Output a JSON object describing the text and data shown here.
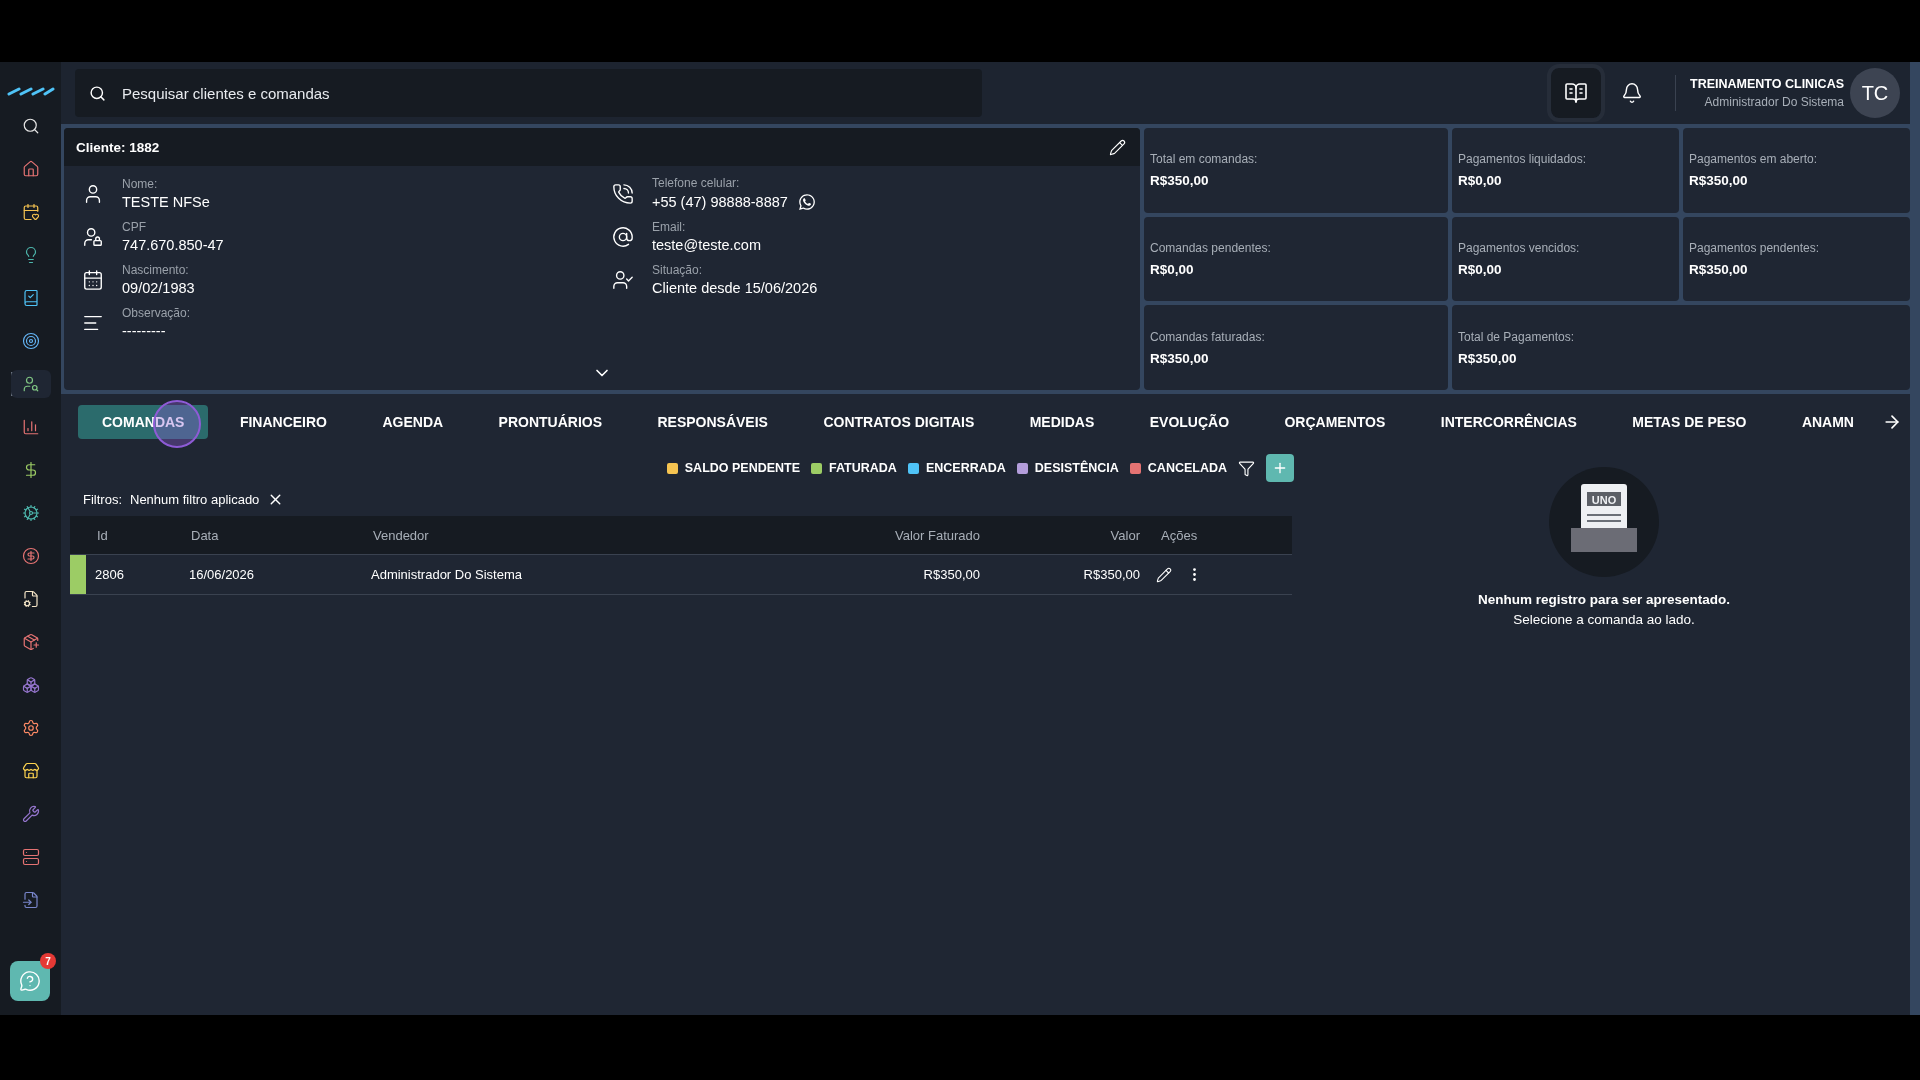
{
  "sidebar": {
    "items": [
      {
        "kind": "search",
        "selected": false
      },
      {
        "kind": "home",
        "selected": false
      },
      {
        "kind": "calendar",
        "selected": false
      },
      {
        "kind": "bulb",
        "selected": false
      },
      {
        "kind": "book",
        "selected": false
      },
      {
        "kind": "target",
        "selected": false
      },
      {
        "kind": "user",
        "selected": true
      },
      {
        "kind": "chart",
        "selected": false
      },
      {
        "kind": "dollar",
        "selected": false
      },
      {
        "kind": "cog",
        "selected": false
      },
      {
        "kind": "coin",
        "selected": false
      },
      {
        "kind": "filecog",
        "selected": false
      },
      {
        "kind": "package",
        "selected": false
      },
      {
        "kind": "boxes",
        "selected": false
      },
      {
        "kind": "settings",
        "selected": false
      },
      {
        "kind": "store",
        "selected": false
      },
      {
        "kind": "wrench",
        "selected": false
      },
      {
        "kind": "server",
        "selected": false
      },
      {
        "kind": "fileinput",
        "selected": false
      }
    ],
    "help_badge": "7"
  },
  "header": {
    "search": {
      "placeholder": "Pesquisar clientes e comandas"
    },
    "user": {
      "name": "TREINAMENTO CLINICAS",
      "role": "Administrador Do Sistema",
      "initials": "TC"
    }
  },
  "client": {
    "title": "Cliente: 1882",
    "left_fields": [
      {
        "kind": "person",
        "label": "Nome:",
        "value": "TESTE NFSe"
      },
      {
        "kind": "idcard",
        "label": "CPF",
        "value": "747.670.850-47"
      },
      {
        "kind": "date",
        "label": "Nascimento:",
        "value": "09/02/1983"
      },
      {
        "kind": "notes",
        "label": "Observação:",
        "value": "---------"
      }
    ],
    "right_fields": [
      {
        "kind": "phone",
        "label": "Telefone celular:",
        "value": "+55 (47) 98888-8887",
        "whatsapp": true
      },
      {
        "kind": "email",
        "label": "Email:",
        "value": "teste@teste.com",
        "whatsapp": false
      },
      {
        "kind": "status",
        "label": "Situação:",
        "value": "Cliente desde 15/06/2026",
        "whatsapp": false
      }
    ]
  },
  "stats": [
    {
      "label": "Total em comandas:",
      "value": "R$350,00",
      "wide": false
    },
    {
      "label": "Pagamentos liquidados:",
      "value": "R$0,00",
      "wide": false
    },
    {
      "label": "Pagamentos em aberto:",
      "value": "R$350,00",
      "wide": false
    },
    {
      "label": "Comandas pendentes:",
      "value": "R$0,00",
      "wide": false
    },
    {
      "label": "Pagamentos vencidos:",
      "value": "R$0,00",
      "wide": false
    },
    {
      "label": "Pagamentos pendentes:",
      "value": "R$350,00",
      "wide": false
    },
    {
      "label": "Comandas faturadas:",
      "value": "R$350,00",
      "wide": false
    },
    {
      "label": "Total de Pagamentos:",
      "value": "R$350,00",
      "wide": true
    }
  ],
  "tabs": [
    {
      "label": "COMANDAS",
      "selected": true
    },
    {
      "label": "FINANCEIRO",
      "selected": false
    },
    {
      "label": "AGENDA",
      "selected": false
    },
    {
      "label": "PRONTUÁRIOS",
      "selected": false
    },
    {
      "label": "RESPONSÁVEIS",
      "selected": false
    },
    {
      "label": "CONTRATOS DIGITAIS",
      "selected": false
    },
    {
      "label": "MEDIDAS",
      "selected": false
    },
    {
      "label": "EVOLUÇÃO",
      "selected": false
    },
    {
      "label": "ORÇAMENTOS",
      "selected": false
    },
    {
      "label": "INTERCORRÊNCIAS",
      "selected": false
    },
    {
      "label": "METAS DE PESO",
      "selected": false
    },
    {
      "label": "ANAMN",
      "selected": false
    }
  ],
  "legend": [
    {
      "label": "SALDO PENDENTE",
      "color": "#f6c451"
    },
    {
      "label": "FATURADA",
      "color": "#9ccc65"
    },
    {
      "label": "ENCERRADA",
      "color": "#4fc3f7"
    },
    {
      "label": "DESISTÊNCIA",
      "color": "#b39ddb"
    },
    {
      "label": "CANCELADA",
      "color": "#e57373"
    }
  ],
  "filters": {
    "label": "Filtros:",
    "value": "Nenhum filtro aplicado"
  },
  "table": {
    "columns": [
      "Id",
      "Data",
      "Vendedor",
      "Valor Faturado",
      "Valor",
      "Ações"
    ],
    "rows": [
      {
        "cells": [
          "2806",
          "16/06/2026",
          "Administrador Do Sistema",
          "R$350,00",
          "R$350,00"
        ],
        "color": "#9ccc65"
      }
    ]
  },
  "empty_state": {
    "illustration_label": "UNO",
    "title": "Nenhum registro para ser apresentado.",
    "subtitle": "Selecione a comanda ao lado."
  }
}
